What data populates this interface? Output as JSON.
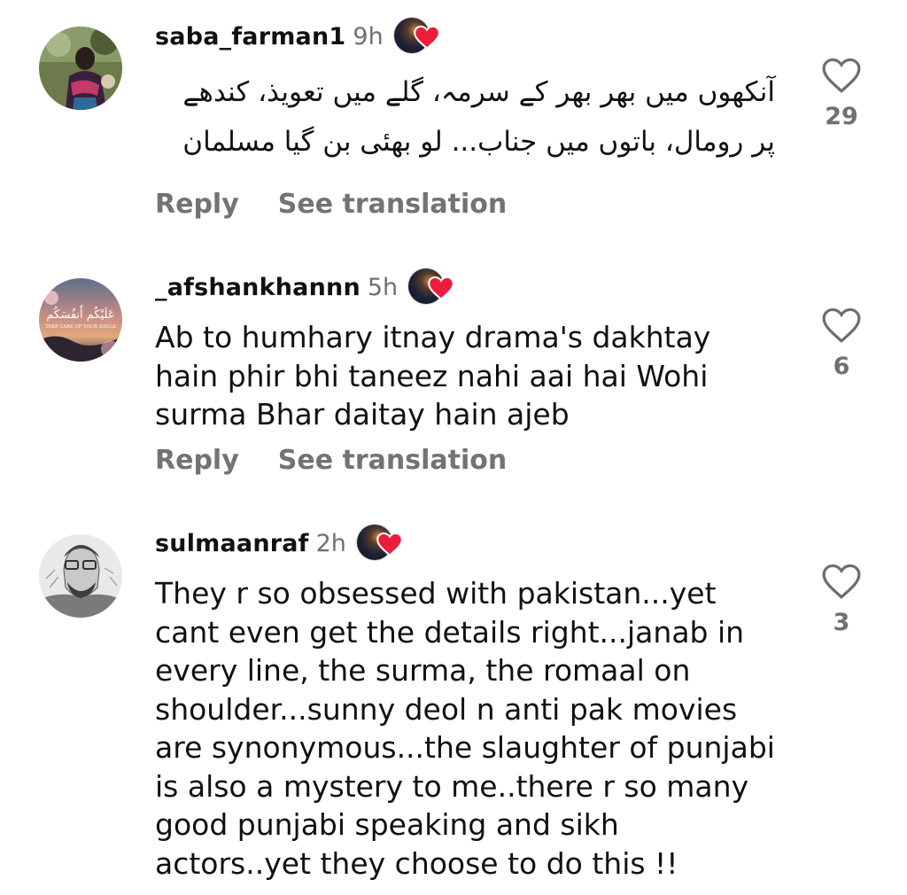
{
  "comments": [
    {
      "username": "saba_farman1",
      "time": "9h",
      "text": "آنکھوں میں بھر بھر کے سرمہ، گلے میں تعویذ، کندھے پر رومال، باتوں میں جناب... لو بھئی بن گیا مسلمان",
      "likes": "29",
      "reply_label": "Reply",
      "translate_label": "See translation"
    },
    {
      "username": "_afshankhannn",
      "time": "5h",
      "avatar_text_arabic": "عَلَيْكُم أَنفُسَكُم",
      "avatar_text": "TAKE CARE OF YOUR SOULS",
      "text": "Ab to humhary itnay drama's dakhtay hain phir bhi taneez nahi aai hai Wohi surma Bhar daitay hain ajeb",
      "likes": "6",
      "reply_label": "Reply",
      "translate_label": "See translation"
    },
    {
      "username": "sulmaanraf",
      "time": "2h",
      "text": "They r so obsessed with pakistan...yet cant even get the details right...janab in every line, the surma, the romaal on shoulder...sunny deol n anti pak movies are synonymous...the slaughter of punjabi is also a mystery to me..there r so many good punjabi speaking and sikh actors..yet they choose to do this !!",
      "likes": "3"
    }
  ],
  "icons": {
    "like": "heart-outline-icon",
    "badge": "story-heart-badge-icon"
  },
  "colors": {
    "text": "#111111",
    "muted": "#737373",
    "heart_red": "#ed1c3a"
  }
}
